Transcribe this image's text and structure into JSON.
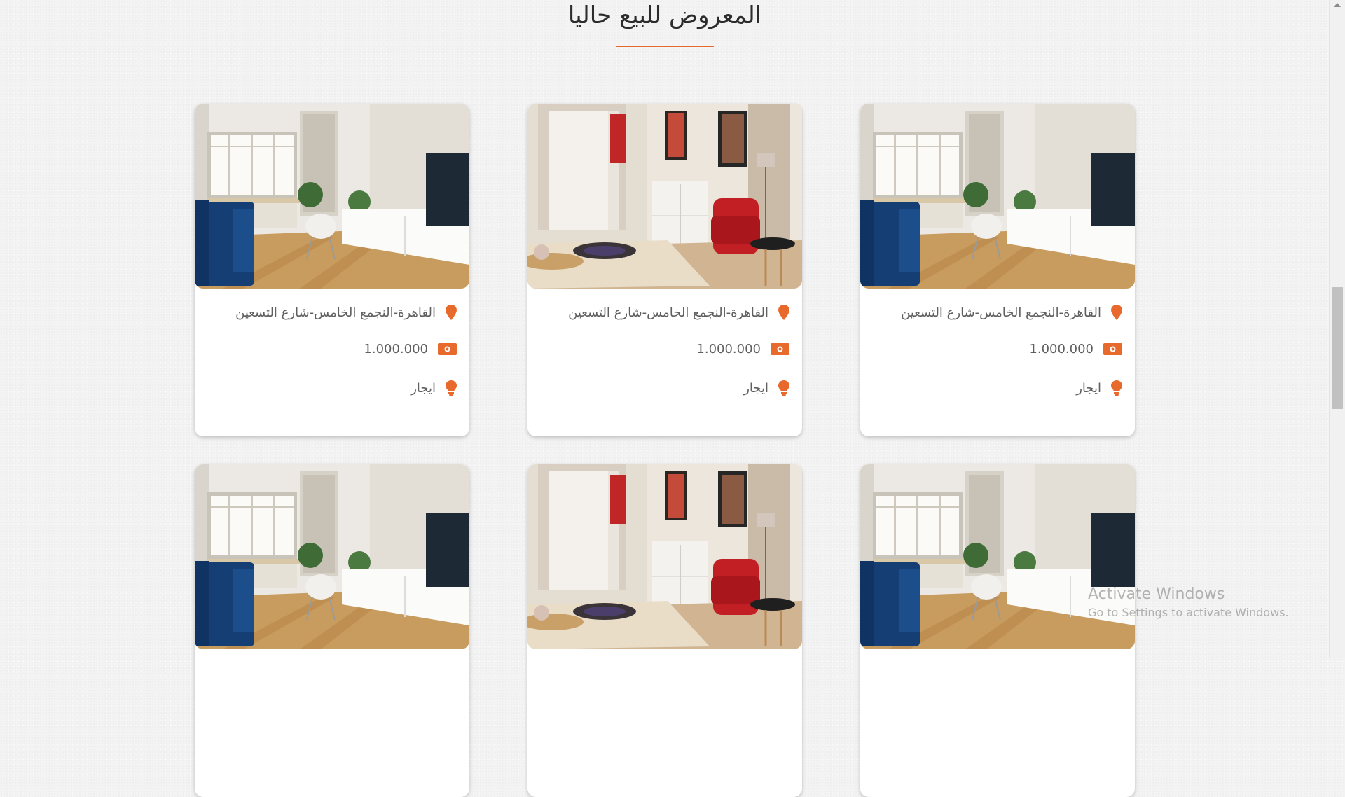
{
  "section": {
    "title": "المعروض للبيع حاليا"
  },
  "accent_color": "#e8692c",
  "cards": [
    {
      "location": "القاهرة-النجمع الخامس-شارع التسعين",
      "price": "1.000.000",
      "type": "ايجار",
      "photo": "living-room-blue-sofa-photo"
    },
    {
      "location": "القاهرة-النجمع الخامس-شارع التسعين",
      "price": "1.000.000",
      "type": "ايجار",
      "photo": "living-room-red-chair-photo"
    },
    {
      "location": "القاهرة-النجمع الخامس-شارع التسعين",
      "price": "1.000.000",
      "type": "ايجار",
      "photo": "living-room-blue-sofa-photo"
    },
    {
      "photo": "living-room-blue-sofa-photo"
    },
    {
      "photo": "living-room-red-chair-photo"
    },
    {
      "photo": "living-room-blue-sofa-photo"
    }
  ],
  "icons": {
    "location": "map-pin-icon",
    "price": "banknote-icon",
    "type": "lightbulb-icon"
  },
  "watermark": {
    "line1": "Activate Windows",
    "line2": "Go to Settings to activate Windows."
  }
}
